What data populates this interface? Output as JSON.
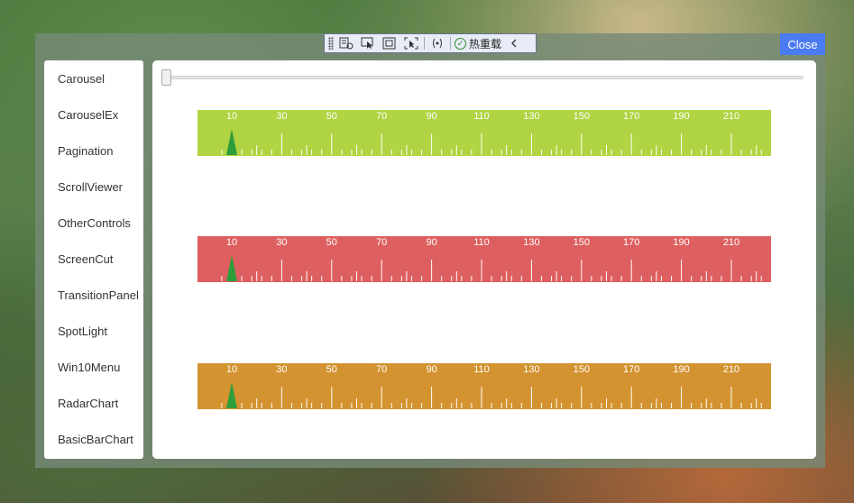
{
  "devbar": {
    "hot_reload_label": "热重载",
    "icons": [
      "live-tree-icon",
      "select-element-icon",
      "display-layout-icon",
      "track-focus-icon",
      "binding-failures-icon"
    ]
  },
  "close_button": {
    "label": "Close"
  },
  "sidebar": {
    "items": [
      {
        "label": "Carousel"
      },
      {
        "label": "CarouselEx"
      },
      {
        "label": "Pagination"
      },
      {
        "label": "ScrollViewer"
      },
      {
        "label": "OtherControls"
      },
      {
        "label": "ScreenCut"
      },
      {
        "label": "TransitionPanel"
      },
      {
        "label": "SpotLight"
      },
      {
        "label": "Win10Menu"
      },
      {
        "label": "RadarChart"
      },
      {
        "label": "BasicBarChart"
      }
    ]
  },
  "slider": {
    "value_fraction": 0.0
  },
  "rulers": {
    "scale_labels": [
      10,
      30,
      50,
      70,
      90,
      110,
      130,
      150,
      170,
      190,
      210
    ],
    "pointer_value": 10,
    "pointer_color": "#2e9e3a",
    "items": [
      {
        "color": "#b0d442"
      },
      {
        "color": "#de5f5f"
      },
      {
        "color": "#d39330"
      }
    ]
  }
}
